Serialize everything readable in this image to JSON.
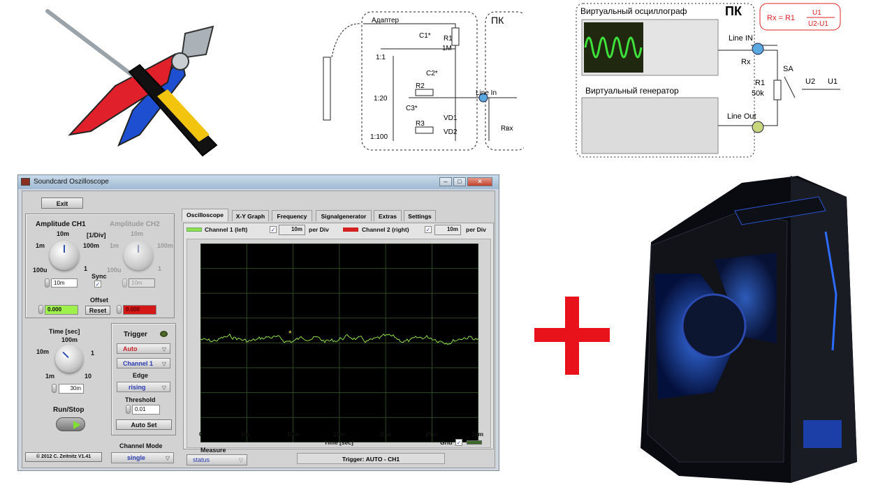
{
  "window": {
    "title": "Soundcard Oszilloscope",
    "exit_label": "Exit",
    "amplitude": {
      "ch1_title": "Amplitude CH1",
      "ch2_title": "Amplitude CH2",
      "unit": "[1/Div]",
      "scale_labels": [
        "100u",
        "1m",
        "10m",
        "100m",
        "1"
      ],
      "ch1_value": "10m",
      "ch2_value": "10m",
      "sync_label": "Sync",
      "sync_checked": true,
      "offset_label": "Offset",
      "offset_ch1": "0.000",
      "offset_ch2": "0.000",
      "reset_label": "Reset"
    },
    "time": {
      "title": "Time [sec]",
      "scale_labels": [
        "1m",
        "10m",
        "100m",
        "1",
        "10"
      ],
      "value": "30m",
      "run_stop_label": "Run/Stop"
    },
    "trigger": {
      "title": "Trigger",
      "mode": "Auto",
      "channel": "Channel 1",
      "edge_label": "Edge",
      "edge": "rising",
      "threshold_label": "Threshold",
      "threshold": "0.01",
      "auto_set_label": "Auto Set"
    },
    "copyright": "© 2012  C. Zeitnitz V1.41",
    "channel_mode_label": "Channel Mode",
    "channel_mode": "single",
    "tabs": [
      {
        "label": "Oscilloscope",
        "active": true
      },
      {
        "label": "X-Y Graph"
      },
      {
        "label": "Frequency"
      },
      {
        "label": "Signalgenerator"
      },
      {
        "label": "Extras"
      },
      {
        "label": "Settings"
      }
    ],
    "channels": {
      "ch1_label": "Channel 1 (left)",
      "ch1_color": "#8fe04a",
      "ch1_per_div": "10m",
      "ch2_label": "Channel 2 (right)",
      "ch2_color": "#d42020",
      "ch2_per_div": "10m",
      "per_div_label": "per Div"
    },
    "plot": {
      "x_ticks": [
        "0",
        "5m",
        "10m",
        "15m",
        "20m",
        "25m",
        "30m"
      ],
      "x_label": "Time [sec]",
      "grid_label": "Grid",
      "grid_checked": true
    },
    "measure_label": "Measure",
    "measure_value": "status",
    "status_text": "Trigger: AUTO - CH1"
  },
  "schematic_adapter": {
    "adapter_label": "Адаптер",
    "pc_label": "ПК",
    "components": [
      "C1*",
      "R1",
      "1M",
      "C2*",
      "R2",
      "C3*",
      "R3",
      "VD1",
      "VD2",
      "Rвх"
    ],
    "ratios": [
      "1:1",
      "1:20",
      "1:100"
    ],
    "line_in": "Line In"
  },
  "schematic_measure": {
    "oscillograph_label": "Виртуальный осциллограф",
    "generator_label": "Виртуальный генератор",
    "pc_label": "ПК",
    "formula": "Rx = R1",
    "formula_num": "U1",
    "formula_den": "U2-U1",
    "line_in": "Line IN",
    "line_out": "Line Out",
    "rx": "Rx",
    "r1": "R1",
    "r1_value": "50k",
    "switch": "SA",
    "u2": "U2",
    "u1": "U1"
  },
  "plus_color": "#e8121a"
}
